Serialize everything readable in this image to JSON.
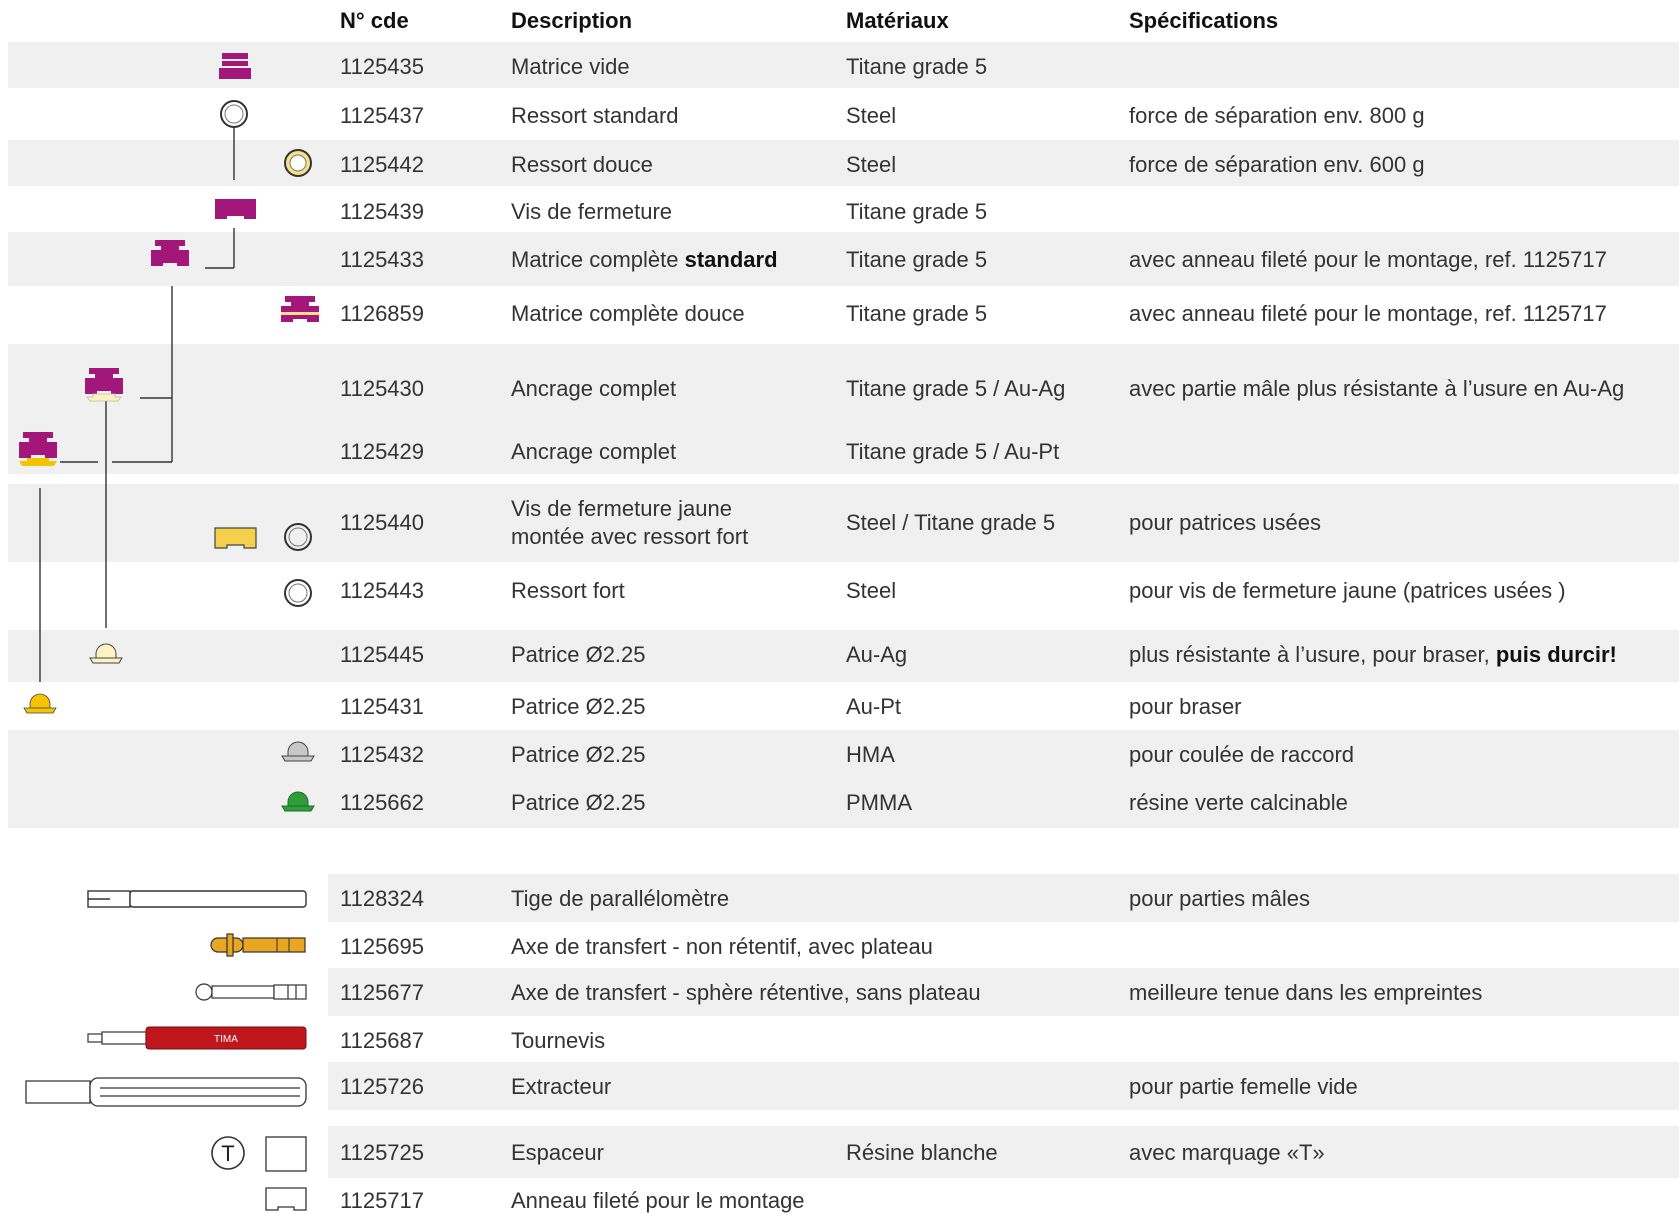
{
  "columns": {
    "number": "N° cde",
    "description": "Description",
    "materials": "Matériaux",
    "specs": "Spécifications"
  },
  "colors": {
    "magenta": "#a3177a",
    "yellow": "#f5d04a",
    "pale_yellow": "#fdf2c4",
    "gold": "#e8a623",
    "green": "#2e9d3a",
    "gray": "#c8c8c8",
    "red": "#c0161d",
    "row_shade": "#f0f0f0"
  },
  "rows": [
    {
      "number": "1125435",
      "description": "Matrice vide",
      "materials": "Titane grade 5",
      "specs": "",
      "icon": "matrix-icon"
    },
    {
      "number": "1125437",
      "description": "Ressort standard",
      "materials": "Steel",
      "specs": "force de séparation env. 800 g",
      "icon": "spring-ring-icon"
    },
    {
      "number": "1125442",
      "description": "Ressort douce",
      "materials": "Steel",
      "specs": "force de séparation env. 600 g",
      "icon": "soft-spring-ring-icon"
    },
    {
      "number": "1125439",
      "description": "Vis de fermeture",
      "materials": "Titane grade 5",
      "specs": "",
      "icon": "closing-screw-icon"
    },
    {
      "number": "1125433",
      "description": "Matrice complète ",
      "description_bold": "standard",
      "materials": "Titane grade 5",
      "specs": "avec anneau fileté pour le montage, ref. 1125717",
      "icon": "complete-matrix-icon"
    },
    {
      "number": "1126859",
      "description": "Matrice complète douce",
      "materials": "Titane grade 5",
      "specs": "avec anneau fileté pour le montage, ref. 1125717",
      "icon": "complete-matrix-soft-icon"
    },
    {
      "number": "1125430",
      "description": "Ancrage complet",
      "materials": "Titane grade 5 / Au-Ag",
      "specs": "avec partie mâle plus résistante à l’usure en Au-Ag",
      "icon": "complete-anchor-au-ag-icon"
    },
    {
      "number": "1125429",
      "description": "Ancrage complet",
      "materials": "Titane grade 5 / Au-Pt",
      "specs": "",
      "icon": "complete-anchor-au-pt-icon"
    },
    {
      "number": "1125440",
      "description": "Vis de fermeture jaune",
      "description_line2": "montée avec ressort fort",
      "materials": "Steel / Titane grade 5",
      "specs": "pour patrices usées",
      "icon": "yellow-closing-screw-icon"
    },
    {
      "number": "1125443",
      "description": "Ressort fort",
      "materials": "Steel",
      "specs": "pour vis de fermeture jaune (patrices usées )",
      "icon": "strong-spring-ring-icon"
    },
    {
      "number": "1125445",
      "description": "Patrice Ø2.25",
      "materials": "Au-Ag",
      "specs": "plus résistante à l’usure, pour braser, ",
      "specs_bold": "puis durcir!",
      "icon": "patrix-au-ag-icon"
    },
    {
      "number": "1125431",
      "description": "Patrice Ø2.25",
      "materials": "Au-Pt",
      "specs": "pour braser",
      "icon": "patrix-au-pt-icon"
    },
    {
      "number": "1125432",
      "description": "Patrice Ø2.25",
      "materials": "HMA",
      "specs": "pour coulée de raccord",
      "icon": "patrix-hma-icon"
    },
    {
      "number": "1125662",
      "description": "Patrice Ø2.25",
      "materials": "PMMA",
      "specs": "résine verte calcinable",
      "icon": "patrix-pmma-icon"
    }
  ],
  "tools": [
    {
      "number": "1128324",
      "description": "Tige de parallélomètre",
      "materials": "",
      "specs": "pour parties mâles",
      "icon": "parallelometer-rod-icon"
    },
    {
      "number": "1125695",
      "description": "Axe de transfert - non rétentif, avec plateau",
      "materials": "",
      "specs": "",
      "icon": "transfer-post-plate-icon"
    },
    {
      "number": "1125677",
      "description": "Axe de transfert - sphère rétentive, sans plateau",
      "materials": "",
      "specs": "meilleure tenue dans les empreintes",
      "icon": "transfer-post-sphere-icon"
    },
    {
      "number": "1125687",
      "description": "Tournevis",
      "materials": "",
      "specs": "",
      "icon": "screwdriver-icon",
      "icon_text": "TIMA"
    },
    {
      "number": "1125726",
      "description": "Extracteur",
      "materials": "",
      "specs": "pour partie femelle vide",
      "icon": "extractor-icon"
    },
    {
      "number": "1125725",
      "description": "Espaceur",
      "materials": "Résine blanche",
      "specs": "avec marquage «T»",
      "icon": "spacer-icon",
      "icon_text": "T"
    },
    {
      "number": "1125717",
      "description": "Anneau fileté pour le montage",
      "materials": "",
      "specs": "",
      "icon": "threaded-ring-icon"
    }
  ]
}
